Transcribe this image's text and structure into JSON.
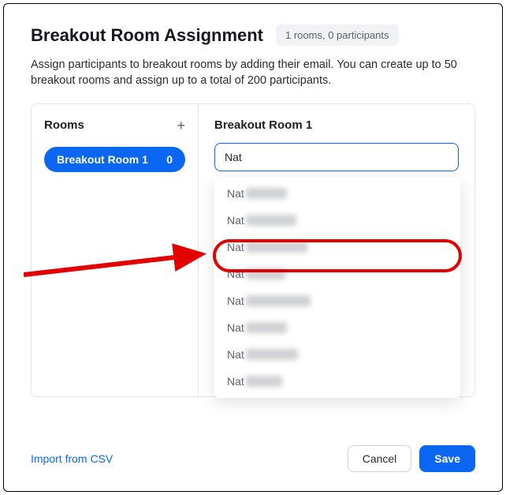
{
  "header": {
    "title": "Breakout Room Assignment",
    "summary": "1 rooms, 0 participants"
  },
  "description": "Assign participants to breakout rooms by adding their email. You can create up to 50 breakout rooms and assign up to a total of 200 participants.",
  "rooms": {
    "heading": "Rooms",
    "items": [
      {
        "name": "Breakout Room 1",
        "count": "0"
      }
    ]
  },
  "detail": {
    "title": "Breakout Room 1",
    "searchValue": "Nat",
    "suggestions": [
      {
        "prefix": "Nat",
        "blurWidth": 52
      },
      {
        "prefix": "Nat",
        "blurWidth": 64
      },
      {
        "prefix": "Nat",
        "blurWidth": 78
      },
      {
        "prefix": "Nat",
        "blurWidth": 50
      },
      {
        "prefix": "Nat",
        "blurWidth": 82
      },
      {
        "prefix": "Nat",
        "blurWidth": 52
      },
      {
        "prefix": "Nat",
        "blurWidth": 66
      },
      {
        "prefix": "Nat",
        "blurWidth": 46
      }
    ]
  },
  "footer": {
    "importLabel": "Import from CSV",
    "cancelLabel": "Cancel",
    "saveLabel": "Save"
  },
  "colors": {
    "accent": "#0b66f2",
    "annotation": "#e30000"
  }
}
